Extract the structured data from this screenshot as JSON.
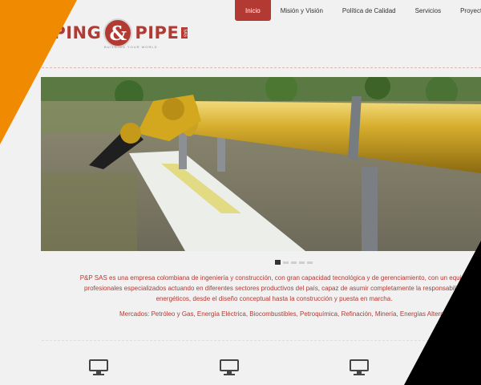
{
  "logo": {
    "word_left": "IPING",
    "ampersand": "&",
    "word_right": "PIPE",
    "tagline": "BUILDING YOUR WORLD",
    "suffix": "SAS"
  },
  "nav": {
    "items": [
      {
        "label": "Inicio",
        "active": true
      },
      {
        "label": "Misión y Visión",
        "active": false
      },
      {
        "label": "Política de Calidad",
        "active": false
      },
      {
        "label": "Servicios",
        "active": false
      },
      {
        "label": "Proyectos re",
        "active": false
      }
    ]
  },
  "slider": {
    "image": "yellow-gas-pipeline-photo",
    "slides_count": 5,
    "active_slide": 1
  },
  "intro": {
    "line1": "P&P SAS es una empresa colombiana de ingeniería y construcción, con gran capacidad tecnológica y de gerenciamiento, con un equipo",
    "line2": "profesionales especializados actuando en diferentes sectores productivos del país, capaz de asumir completamente la responsabilida",
    "line3": "energéticos, desde el diseño conceptual hasta la construcción y puesta en marcha.",
    "markets": "Mercados: Petróleo y Gas, Energía Eléctrica, Biocombustibles, Petroquímica, Refinación, Minería, Energías Alterna"
  },
  "features": {
    "icons": [
      "monitor-icon",
      "monitor-icon",
      "monitor-icon"
    ]
  },
  "colors": {
    "brand": "#b23a33",
    "accent_orange": "#f08a00",
    "background": "#f1f1f1"
  }
}
